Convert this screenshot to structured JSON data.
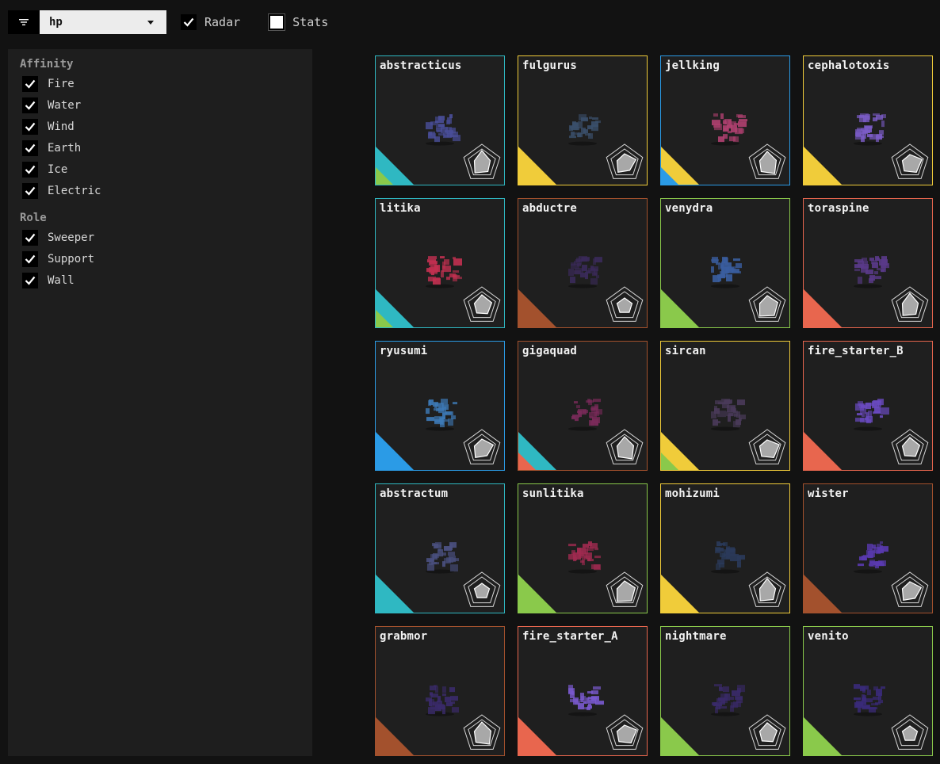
{
  "toolbar": {
    "filter_icon": "filter-icon",
    "sort_value": "hp",
    "radar_label": "Radar",
    "radar_checked": true,
    "stats_label": "Stats",
    "stats_checked": false
  },
  "sidebar": {
    "affinity_title": "Affinity",
    "affinity": [
      {
        "label": "Fire",
        "checked": true
      },
      {
        "label": "Water",
        "checked": true
      },
      {
        "label": "Wind",
        "checked": true
      },
      {
        "label": "Earth",
        "checked": true
      },
      {
        "label": "Ice",
        "checked": true
      },
      {
        "label": "Electric",
        "checked": true
      }
    ],
    "role_title": "Role",
    "role": [
      {
        "label": "Sweeper",
        "checked": true
      },
      {
        "label": "Support",
        "checked": true
      },
      {
        "label": "Wall",
        "checked": true
      }
    ]
  },
  "colors": {
    "fire": "#e8664e",
    "water": "#2b9be6",
    "wind": "#8ac94b",
    "earth": "#a3512d",
    "ice": "#2fb8c2",
    "electric": "#f0cc3a"
  },
  "cards": [
    {
      "name": "abstracticus",
      "border": "#2fb8c2",
      "tri": "#2fb8c2",
      "tri2": "#8ac94b",
      "sprite": "#4a4f9a"
    },
    {
      "name": "fulgurus",
      "border": "#f0cc3a",
      "tri": "#f0cc3a",
      "tri2": "",
      "sprite": "#3a4f6a"
    },
    {
      "name": "jellking",
      "border": "#2b9be6",
      "tri": "#f0cc3a",
      "tri2": "#2b9be6",
      "sprite": "#b04070"
    },
    {
      "name": "cephalotoxis",
      "border": "#f0cc3a",
      "tri": "#f0cc3a",
      "tri2": "",
      "sprite": "#7c5cc8"
    },
    {
      "name": "litika",
      "border": "#2fb8c2",
      "tri": "#2fb8c2",
      "tri2": "#8ac94b",
      "sprite": "#c23050"
    },
    {
      "name": "abductre",
      "border": "#a3512d",
      "tri": "#a3512d",
      "tri2": "",
      "sprite": "#3a2a5a"
    },
    {
      "name": "venydra",
      "border": "#8ac94b",
      "tri": "#8ac94b",
      "tri2": "",
      "sprite": "#3a5ea0"
    },
    {
      "name": "toraspine",
      "border": "#e8664e",
      "tri": "#e8664e",
      "tri2": "",
      "sprite": "#5a3a8a"
    },
    {
      "name": "ryusumi",
      "border": "#2b9be6",
      "tri": "#2b9be6",
      "tri2": "",
      "sprite": "#3d7ab8"
    },
    {
      "name": "gigaquad",
      "border": "#a3512d",
      "tri": "#2fb8c2",
      "tri2": "#e8664e",
      "sprite": "#7a2a5a"
    },
    {
      "name": "sircan",
      "border": "#f0cc3a",
      "tri": "#f0cc3a",
      "tri2": "#8ac94b",
      "sprite": "#4a3a5a"
    },
    {
      "name": "fire_starter_B",
      "border": "#e8664e",
      "tri": "#e8664e",
      "tri2": "",
      "sprite": "#6a4ac0"
    },
    {
      "name": "abstractum",
      "border": "#2fb8c2",
      "tri": "#2fb8c2",
      "tri2": "",
      "sprite": "#4a5080"
    },
    {
      "name": "sunlitika",
      "border": "#8ac94b",
      "tri": "#8ac94b",
      "tri2": "",
      "sprite": "#a02a50"
    },
    {
      "name": "mohizumi",
      "border": "#f0cc3a",
      "tri": "#f0cc3a",
      "tri2": "",
      "sprite": "#2a3a5a"
    },
    {
      "name": "wister",
      "border": "#a3512d",
      "tri": "#a3512d",
      "tri2": "",
      "sprite": "#5a3ab0"
    },
    {
      "name": "grabmor",
      "border": "#a3512d",
      "tri": "#a3512d",
      "tri2": "",
      "sprite": "#3a2a6a"
    },
    {
      "name": "fire_starter_A",
      "border": "#e8664e",
      "tri": "#e8664e",
      "tri2": "",
      "sprite": "#7a5ad0"
    },
    {
      "name": "nightmare",
      "border": "#8ac94b",
      "tri": "#8ac94b",
      "tri2": "",
      "sprite": "#3a2a6a"
    },
    {
      "name": "venito",
      "border": "#8ac94b",
      "tri": "#8ac94b",
      "tri2": "",
      "sprite": "#3a2a7a"
    }
  ]
}
